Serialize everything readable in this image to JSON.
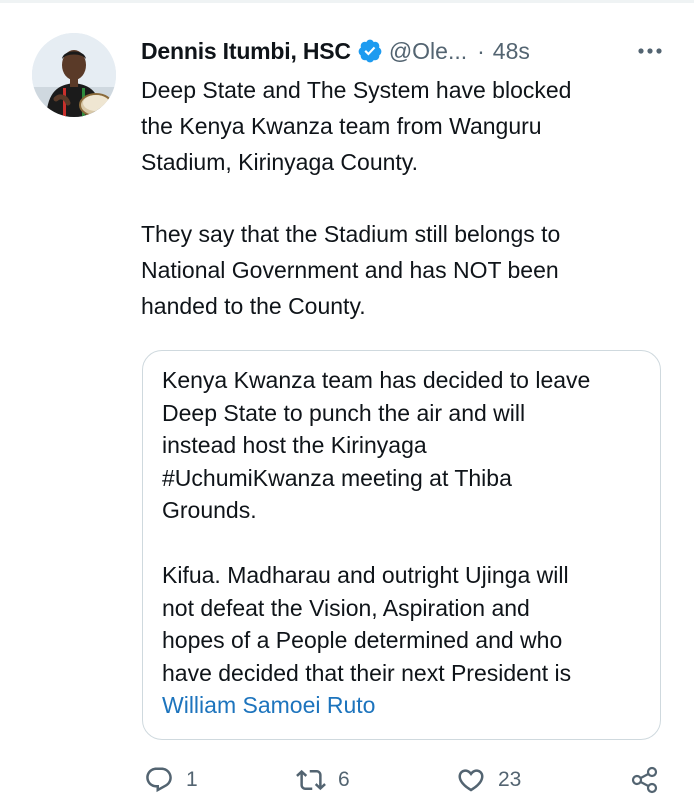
{
  "tweet": {
    "author": {
      "display_name": "Dennis Itumbi, HSC",
      "handle": "@Ole...",
      "verified": true
    },
    "separator": "·",
    "time": "48s",
    "text_paragraphs": [
      [
        "Deep State and The System have blocked",
        "the Kenya Kwanza team from Wanguru",
        "Stadium, Kirinyaga County."
      ],
      [
        "They say that the Stadium still belongs to",
        "National Government and has NOT been",
        "handed to the County."
      ]
    ]
  },
  "quote": {
    "paragraph_1": [
      "Kenya Kwanza team has decided to leave",
      "Deep State to punch the air and will",
      "instead host the Kirinyaga",
      "#UchumiKwanza meeting at Thiba",
      "Grounds."
    ],
    "paragraph_2": [
      "Kifua. Madharau and outright Ujinga will",
      "not defeat the Vision, Aspiration and",
      "hopes of a People determined and who",
      "have decided that their next President is"
    ],
    "link_text": "William Samoei Ruto"
  },
  "actions": {
    "reply_count": "1",
    "retweet_count": "6",
    "like_count": "23"
  },
  "colors": {
    "text": "#0f1419",
    "secondary": "#536471",
    "link": "#1d74bd",
    "verified_badge": "#1d9bf0",
    "border": "#cfd9de"
  },
  "icons": {
    "verified": "verified-badge-icon",
    "more": "more-options-icon",
    "reply": "reply-icon",
    "retweet": "retweet-icon",
    "like": "heart-icon",
    "share": "share-icon"
  }
}
